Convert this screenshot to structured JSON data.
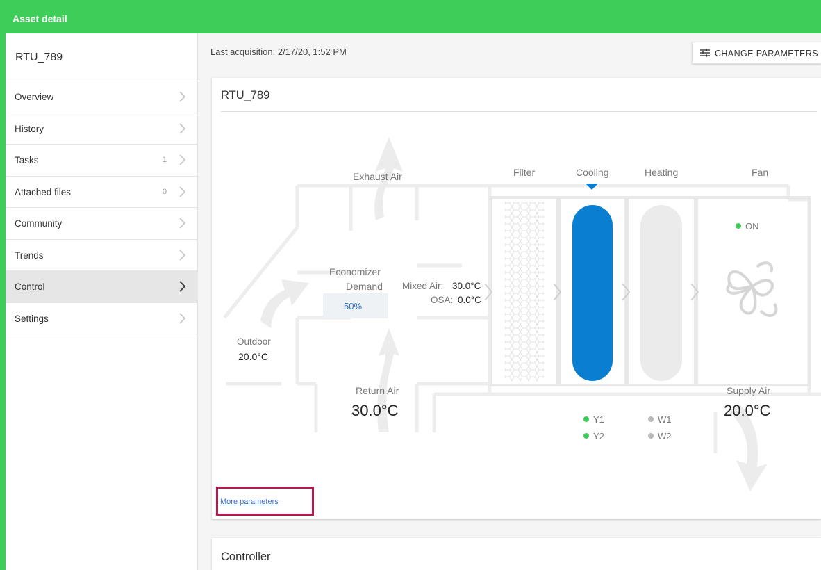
{
  "header": {
    "title": "Asset detail"
  },
  "sidebar": {
    "asset_name": "RTU_789",
    "items": [
      {
        "label": "Overview",
        "count": ""
      },
      {
        "label": "History",
        "count": ""
      },
      {
        "label": "Tasks",
        "count": "1"
      },
      {
        "label": "Attached files",
        "count": "0"
      },
      {
        "label": "Community",
        "count": ""
      },
      {
        "label": "Trends",
        "count": ""
      },
      {
        "label": "Control",
        "count": "",
        "active": true
      },
      {
        "label": "Settings",
        "count": ""
      }
    ]
  },
  "main": {
    "last_acquisition": "Last acquisition: 2/17/20, 1:52 PM",
    "change_parameters": "CHANGE PARAMETERS",
    "card_title": "RTU_789",
    "diagram": {
      "exhaust_air": "Exhaust Air",
      "economizer_label_1": "Economizer",
      "economizer_label_2": "Demand",
      "economizer_value": "50%",
      "mixed_air_label": "Mixed Air:",
      "mixed_air_value": "30.0°C",
      "osa_label": "OSA:",
      "osa_value": "0.0°C",
      "outdoor_label": "Outdoor",
      "outdoor_value": "20.0°C",
      "return_air_label": "Return Air",
      "return_air_value": "30.0°C",
      "filter_label": "Filter",
      "cooling_label": "Cooling",
      "heating_label": "Heating",
      "fan_label": "Fan",
      "fan_status": "ON",
      "supply_air_label": "Supply Air",
      "supply_air_value": "20.0°C",
      "stage_y1": "Y1",
      "stage_y2": "Y2",
      "stage_w1": "W1",
      "stage_w2": "W2"
    },
    "more_parameters": "More parameters",
    "controller_title": "Controller"
  },
  "colors": {
    "brand_green": "#3dcd58",
    "cooling_blue": "#0a7fd1",
    "status_green": "#3dcd58",
    "status_gray": "#bbbbbb",
    "highlight": "#b5174f"
  }
}
